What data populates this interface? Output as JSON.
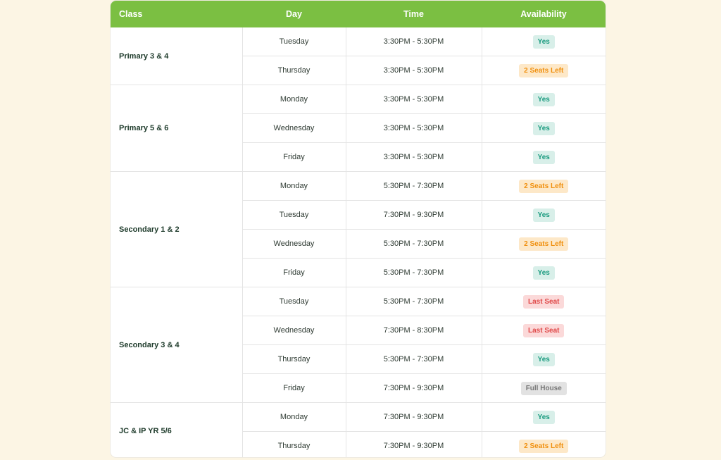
{
  "header": {
    "class": "Class",
    "day": "Day",
    "time": "Time",
    "availability": "Availability"
  },
  "groups": [
    {
      "name": "Primary 3 & 4",
      "sessions": [
        {
          "day": "Tuesday",
          "time": "3:30PM - 5:30PM",
          "availability": "Yes",
          "status": "yes"
        },
        {
          "day": "Thursday",
          "time": "3:30PM - 5:30PM",
          "availability": "2 Seats Left",
          "status": "seats"
        }
      ]
    },
    {
      "name": "Primary 5 & 6",
      "sessions": [
        {
          "day": "Monday",
          "time": "3:30PM - 5:30PM",
          "availability": "Yes",
          "status": "yes"
        },
        {
          "day": "Wednesday",
          "time": "3:30PM - 5:30PM",
          "availability": "Yes",
          "status": "yes"
        },
        {
          "day": "Friday",
          "time": "3:30PM - 5:30PM",
          "availability": "Yes",
          "status": "yes"
        }
      ]
    },
    {
      "name": "Secondary 1 & 2",
      "sessions": [
        {
          "day": "Monday",
          "time": "5:30PM - 7:30PM",
          "availability": "2 Seats Left",
          "status": "seats"
        },
        {
          "day": "Tuesday",
          "time": "7:30PM - 9:30PM",
          "availability": "Yes",
          "status": "yes"
        },
        {
          "day": "Wednesday",
          "time": "5:30PM - 7:30PM",
          "availability": "2 Seats Left",
          "status": "seats"
        },
        {
          "day": "Friday",
          "time": "5:30PM - 7:30PM",
          "availability": "Yes",
          "status": "yes"
        }
      ]
    },
    {
      "name": "Secondary 3 & 4",
      "sessions": [
        {
          "day": "Tuesday",
          "time": "5:30PM - 7:30PM",
          "availability": "Last Seat",
          "status": "last"
        },
        {
          "day": "Wednesday",
          "time": "7:30PM - 8:30PM",
          "availability": "Last Seat",
          "status": "last"
        },
        {
          "day": "Thursday",
          "time": "5:30PM - 7:30PM",
          "availability": "Yes",
          "status": "yes"
        },
        {
          "day": "Friday",
          "time": "7:30PM - 9:30PM",
          "availability": "Full House",
          "status": "full"
        }
      ]
    },
    {
      "name": "JC & IP YR 5/6",
      "sessions": [
        {
          "day": "Monday",
          "time": "7:30PM - 9:30PM",
          "availability": "Yes",
          "status": "yes"
        },
        {
          "day": "Thursday",
          "time": "7:30PM - 9:30PM",
          "availability": "2 Seats Left",
          "status": "seats"
        }
      ]
    }
  ],
  "colors": {
    "header_green": "#7bbf42",
    "page_background": "#fcf5e4",
    "yes": "#1a9b7f",
    "seats_left": "#f0900f",
    "last_seat": "#e04848",
    "full_house": "#777777"
  }
}
